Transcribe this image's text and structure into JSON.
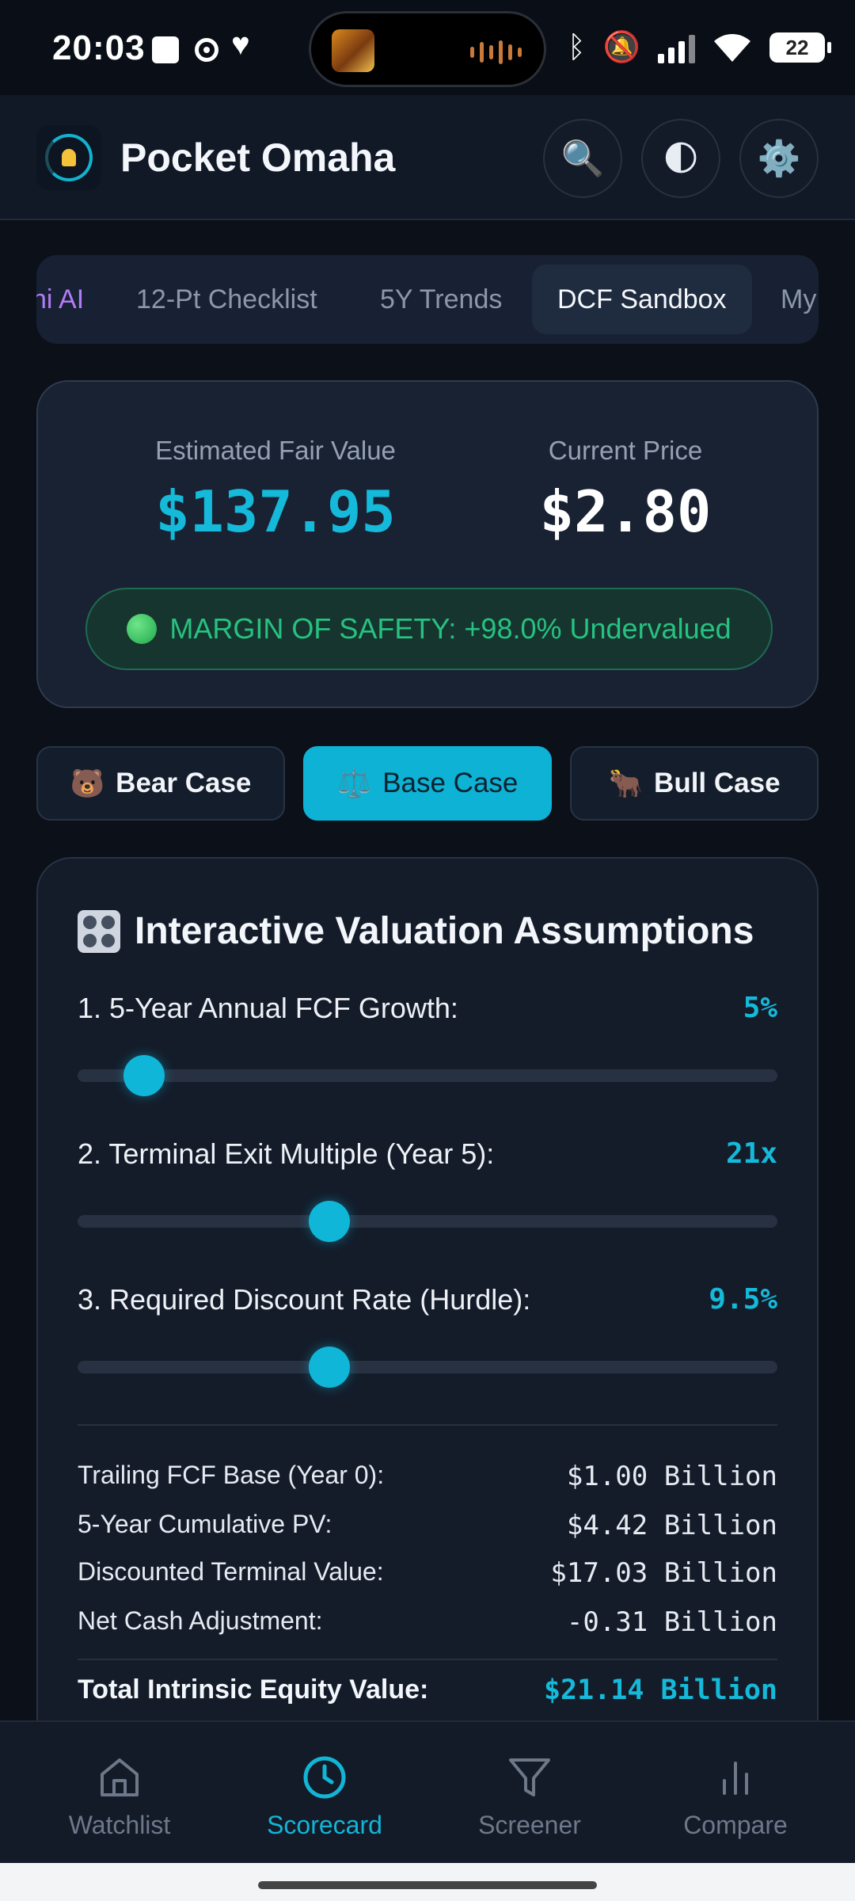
{
  "status_bar": {
    "time": "20:03",
    "battery": "22"
  },
  "header": {
    "title": "Pocket Omaha",
    "search_icon": "🔍",
    "theme_icon": "🌓",
    "settings_icon": "⚙️"
  },
  "tabs": [
    {
      "label": "ni AI"
    },
    {
      "label": "12-Pt Checklist"
    },
    {
      "label": "5Y Trends"
    },
    {
      "label": "DCF Sandbox",
      "active": true
    },
    {
      "label": "My"
    }
  ],
  "valuation": {
    "fair_value_label": "Estimated Fair Value",
    "fair_value": "$137.95",
    "current_price_label": "Current Price",
    "current_price": "$2.80",
    "margin_text": "MARGIN OF SAFETY: +98.0% Undervalued"
  },
  "scenarios": [
    {
      "emoji": "🐻",
      "label": "Bear Case"
    },
    {
      "emoji": "⚖️",
      "label": "Base Case",
      "active": true
    },
    {
      "emoji": "🐂",
      "label": "Bull Case"
    }
  ],
  "assumptions": {
    "title": "Interactive Valuation Assumptions",
    "sliders": [
      {
        "label": "1. 5-Year Annual FCF Growth:",
        "value": "5%",
        "level": 0.095
      },
      {
        "label": "2. Terminal Exit Multiple (Year 5):",
        "value": "21x",
        "level": 0.36
      },
      {
        "label": "3. Required Discount Rate (Hurdle):",
        "value": "9.5%",
        "level": 0.36
      }
    ],
    "summary": [
      {
        "label": "Trailing FCF Base (Year 0):",
        "value": "$1.00 Billion"
      },
      {
        "label": "5-Year Cumulative PV:",
        "value": "$4.42 Billion"
      },
      {
        "label": "Discounted Terminal Value:",
        "value": "$17.03 Billion"
      },
      {
        "label": "Net Cash Adjustment:",
        "value": "-0.31 Billion"
      }
    ],
    "total_label": "Total Intrinsic Equity Value:",
    "total_value": "$21.14 Billion"
  },
  "bottom_nav": [
    {
      "label": "Watchlist",
      "icon": "home-icon"
    },
    {
      "label": "Scorecard",
      "icon": "clock-icon",
      "active": true
    },
    {
      "label": "Screener",
      "icon": "filter-icon"
    },
    {
      "label": "Compare",
      "icon": "bar-chart-icon"
    }
  ],
  "colors": {
    "accent": "#12b5d6",
    "success": "#26c281",
    "ai_tab": "#b27cf5",
    "background": "#0b1019"
  }
}
